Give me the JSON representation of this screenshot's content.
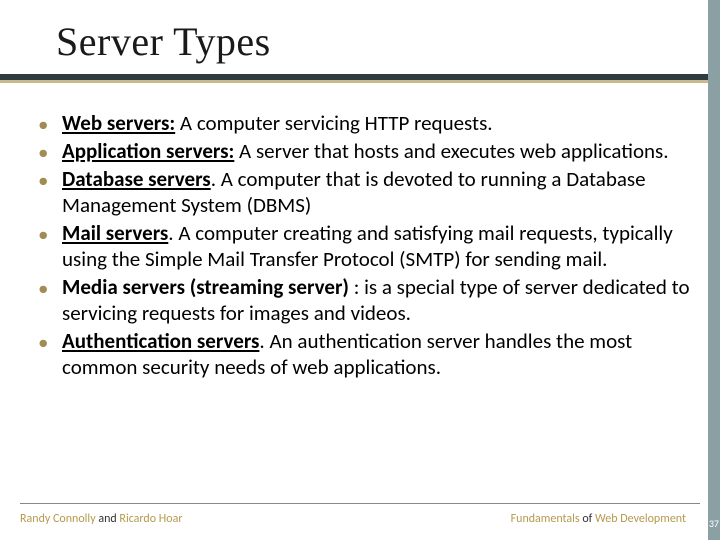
{
  "title": "Server Types",
  "bullets": [
    {
      "term": "Web servers:",
      "underline": true,
      "text": " A computer servicing HTTP requests."
    },
    {
      "term": "Application servers:",
      "underline": true,
      "text": " A server that hosts and executes web applications."
    },
    {
      "term": "Database servers",
      "underline": true,
      "text": ". A computer that is devoted to running a Database Management System (DBMS)"
    },
    {
      "term": "Mail servers",
      "underline": true,
      "text": ". A computer creating and satisfying mail requests, typically using the Simple Mail Transfer Protocol (SMTP) for sending mail."
    },
    {
      "term": "Media servers (streaming server)",
      "underline": false,
      "text": " : is a special type of server dedicated to servicing requests for images and videos."
    },
    {
      "term": "Authentication servers",
      "underline": true,
      "text": ". An authentication server handles the most common security needs of web applications."
    }
  ],
  "footer": {
    "left_a": "Randy Connolly",
    "left_mid": " and ",
    "left_b": "Ricardo Hoar",
    "right_a": "Fundamentals",
    "right_mid": " of ",
    "right_b": "Web Development"
  },
  "pagenum": "37"
}
